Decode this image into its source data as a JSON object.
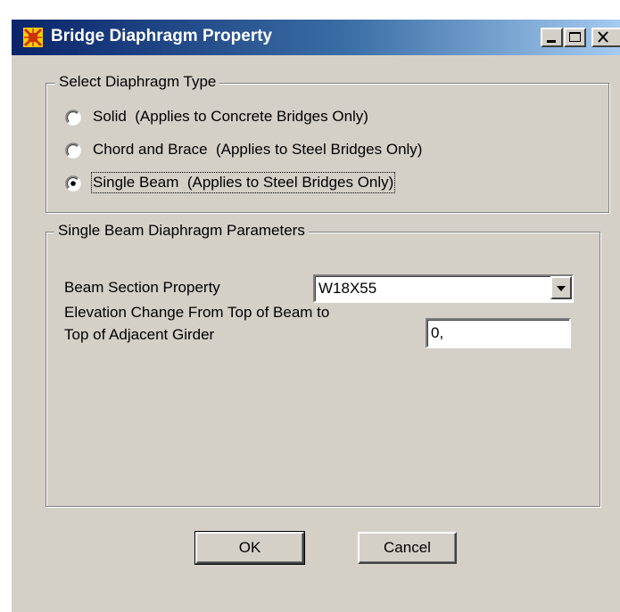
{
  "window": {
    "title": "Bridge Diaphragm Property",
    "icon": "app-logo-icon",
    "controls": [
      "minimize-icon",
      "maximize-icon",
      "close-icon"
    ]
  },
  "diaphragm_type": {
    "legend": "Select Diaphragm Type",
    "options": [
      {
        "label": "Solid  (Applies to Concrete Bridges Only)",
        "selected": false
      },
      {
        "label": "Chord and Brace  (Applies to Steel Bridges Only)",
        "selected": false
      },
      {
        "label": "Single Beam  (Applies to Steel Bridges Only)",
        "selected": true
      }
    ]
  },
  "single_beam": {
    "legend": "Single Beam Diaphragm Parameters",
    "section_label": "Beam Section Property",
    "section_value": "W18X55",
    "elevation_label_line1": "Elevation Change From Top of Beam to",
    "elevation_label_line2": "Top of Adjacent Girder",
    "elevation_value": "0,"
  },
  "buttons": {
    "ok": "OK",
    "cancel": "Cancel"
  },
  "colors": {
    "dialog_face": "#d4d0c8",
    "title_start": "#0a246a",
    "title_end": "#a6caf0",
    "app_icon": "#ffcc00"
  }
}
